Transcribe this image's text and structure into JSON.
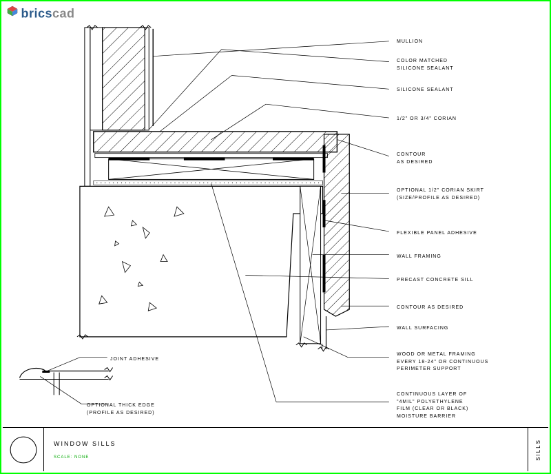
{
  "logo": {
    "name": "bricscad"
  },
  "title_block": {
    "title": "WINDOW SILLS",
    "scale": "SCALE: NONE",
    "sheet": "SILLS"
  },
  "labels": {
    "mullion": "MULLION",
    "color_matched": "COLOR MATCHED\nSILICONE SEALANT",
    "silicone_sealant": "SILICONE SEALANT",
    "corian_thickness": "1/2\" OR 3/4\" CORIAN",
    "contour_desired_top": "CONTOUR\nAS DESIRED",
    "optional_skirt": "OPTIONAL 1/2\" CORIAN SKIRT\n(SIZE/PROFILE AS DESIRED)",
    "flexible_adhesive": "FLEXIBLE PANEL ADHESIVE",
    "wall_framing": "WALL FRAMING",
    "precast_sill": "PRECAST CONCRETE SILL",
    "contour_desired_bottom": "CONTOUR AS DESIRED",
    "wall_surfacing": "WALL SURFACING",
    "wood_metal_framing": "WOOD OR METAL FRAMING\nEVERY 18-24\" OR CONTINUOUS\nPERIMETER SUPPORT",
    "continuous_layer": "CONTINUOUS LAYER OF\n\"4MIL\" POLYETHYLENE\nFILM (CLEAR OR BLACK)\nMOISTURE BARRIER",
    "joint_adhesive": "JOINT ADHESIVE",
    "optional_thick_edge": "OPTIONAL THICK EDGE\n(PROFILE AS DESIRED)"
  }
}
